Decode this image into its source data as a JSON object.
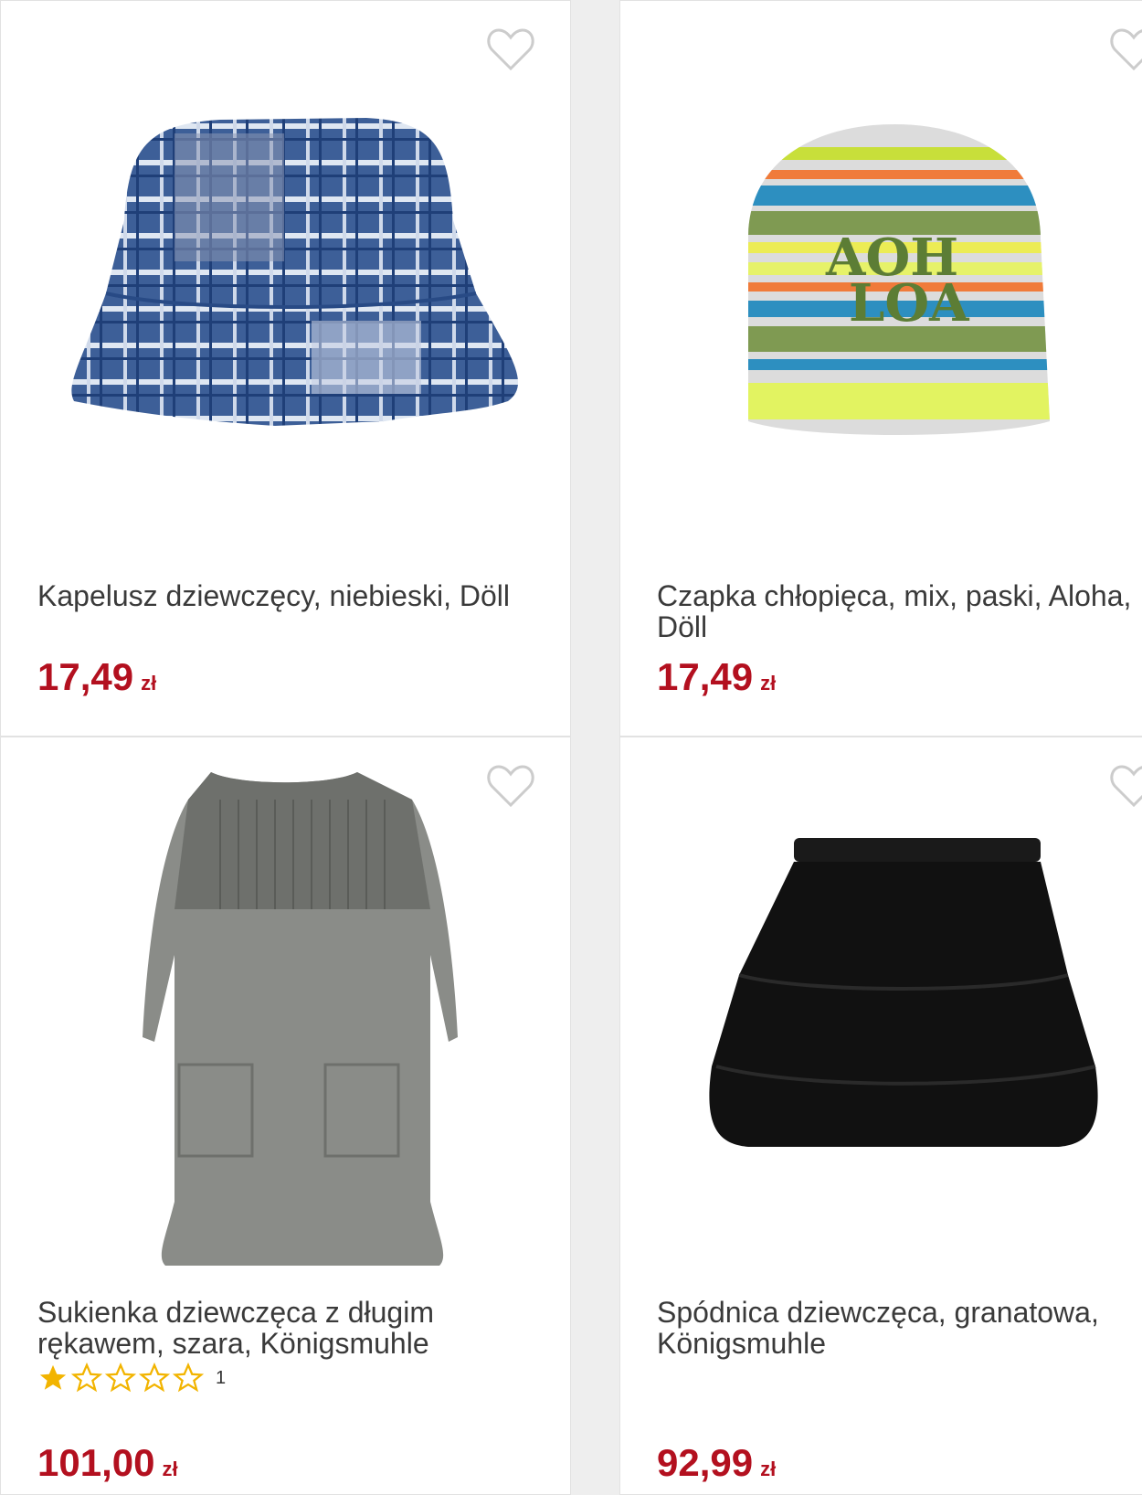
{
  "products": [
    {
      "title": "Kapelusz dziewczęcy, niebieski, Döll",
      "price": "17,49",
      "currency": "zł",
      "icon": "heart-outline-icon"
    },
    {
      "title": "Czapka chłopięca, mix, paski, Aloha, Döll",
      "price": "17,49",
      "currency": "zł",
      "icon": "heart-outline-icon"
    },
    {
      "title": "Sukienka dziewczęca z długim rękawem, szara, Königsmuhle",
      "price": "101,00",
      "currency": "zł",
      "rating": {
        "value": 1,
        "max": 5,
        "count": "1"
      },
      "icon": "heart-outline-icon"
    },
    {
      "title": "Spódnica dziewczęca, granatowa, Königsmuhle",
      "price": "92,99",
      "currency": "zł",
      "icon": "heart-outline-icon"
    }
  ],
  "colors": {
    "price": "#b3101f",
    "star": "#f2b400",
    "heart": "#cccccc"
  }
}
